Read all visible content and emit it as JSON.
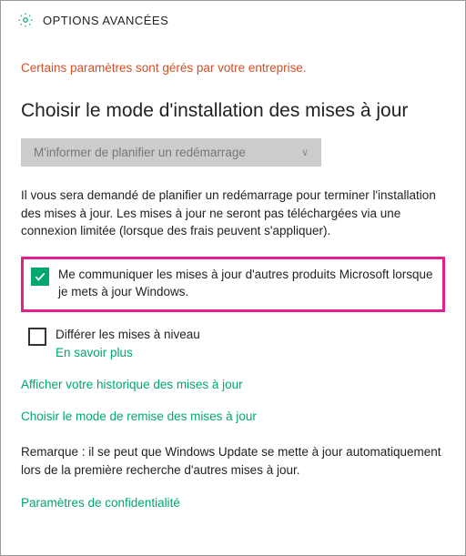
{
  "header": {
    "title": "OPTIONS AVANCÉES"
  },
  "enterprise_message": "Certains paramètres sont gérés par votre entreprise.",
  "section_title": "Choisir le mode d'installation des mises à jour",
  "dropdown": {
    "selected": "M'informer de planifier un redémarrage"
  },
  "description": "Il vous sera demandé de planifier un redémarrage pour terminer l'installation des mises à jour. Les mises à jour ne seront pas téléchargées via une connexion limitée (lorsque des frais peuvent s'appliquer).",
  "checkbox_other_products": {
    "checked": true,
    "label": "Me communiquer les mises à jour d'autres produits Microsoft lorsque je mets à jour Windows."
  },
  "checkbox_defer": {
    "checked": false,
    "label": "Différer les mises à niveau",
    "learn_more": "En savoir plus"
  },
  "links": {
    "history": "Afficher votre historique des mises à jour",
    "delivery": "Choisir le mode de remise des mises à jour"
  },
  "remark": "Remarque : il se peut que Windows Update se mette à jour automatiquement lors de la première recherche d'autres mises à jour.",
  "privacy": "Paramètres de confidentialité"
}
